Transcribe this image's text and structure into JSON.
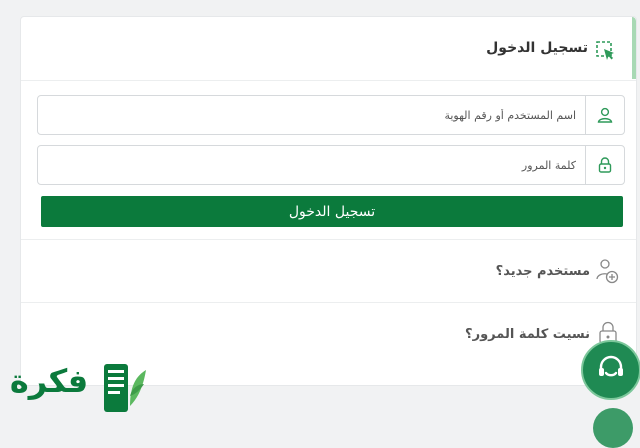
{
  "header": {
    "title": "تسجيل الدخول",
    "icon": "login-cursor-icon"
  },
  "form": {
    "username_placeholder": "اسم المستخدم أو رقم الهوية",
    "username_value": "",
    "username_icon": "user-icon",
    "password_placeholder": "كلمة المرور",
    "password_value": "",
    "password_icon": "lock-icon",
    "submit_label": "تسجيل الدخول"
  },
  "links": {
    "new_user": "مستخدم جديد؟",
    "new_user_icon": "add-user-icon",
    "forgot_password": "نسيت كلمة المرور؟",
    "forgot_password_icon": "lock-icon"
  },
  "branding": {
    "logo_text": "فكرة"
  },
  "colors": {
    "primary": "#0b7a3c",
    "accent": "#a8d9b4",
    "icon_green": "#2f9a5a"
  }
}
